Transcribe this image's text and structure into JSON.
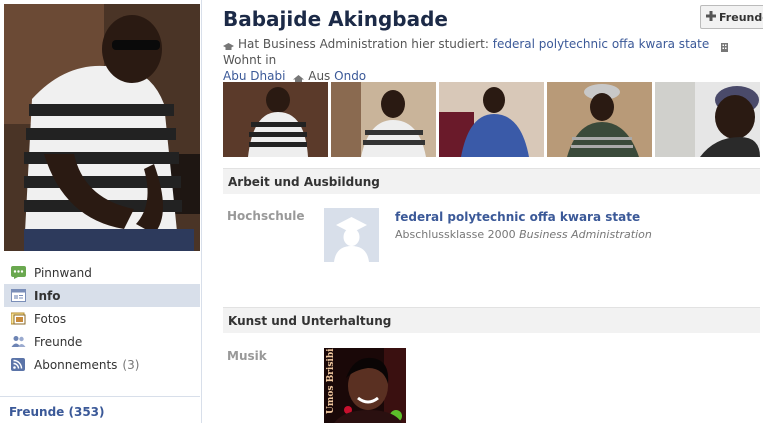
{
  "profile": {
    "name": "Babajide Akingbade",
    "friend_button": "Freunde",
    "info": {
      "studied_prefix": "Hat Business Administration hier studiert:",
      "school_link": "federal polytechnic offa kwara state",
      "lives_label": "Wohnt in",
      "lives_city": "Abu Dhabi",
      "from_label": "Aus",
      "from_city": "Ondo"
    }
  },
  "nav": {
    "items": [
      {
        "label": "Pinnwand",
        "icon": "wall-icon"
      },
      {
        "label": "Info",
        "icon": "info-icon",
        "active": true
      },
      {
        "label": "Fotos",
        "icon": "photos-icon"
      },
      {
        "label": "Freunde",
        "icon": "friends-icon"
      },
      {
        "label": "Abonnements",
        "count": "(3)",
        "icon": "subscriptions-icon"
      }
    ],
    "friends_header": "Freunde (353)"
  },
  "sections": {
    "work": {
      "title": "Arbeit und Ausbildung",
      "school_label": "Hochschule",
      "school_name": "federal polytechnic offa kwara state",
      "class_year": "Abschlussklasse 2000",
      "concentration": "Business Administration"
    },
    "arts": {
      "title": "Kunst und Unterhaltung",
      "music_label": "Musik",
      "album_text": "Umos Brisibi"
    }
  },
  "colors": {
    "link": "#3b5998",
    "name": "#1c2a47",
    "nav_active_bg": "#d8dfea",
    "section_bg": "#f2f2f2"
  }
}
